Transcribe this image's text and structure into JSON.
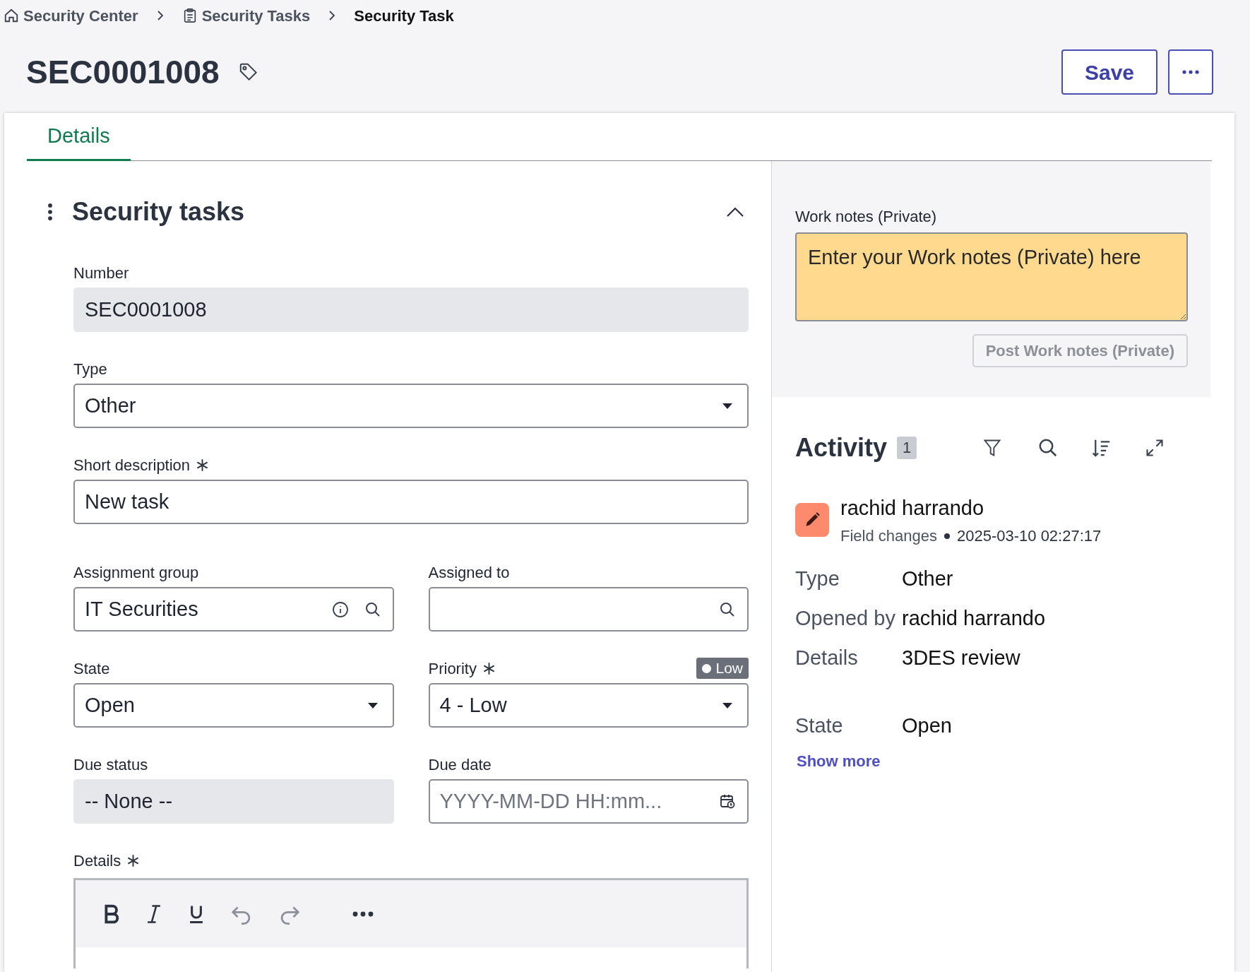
{
  "breadcrumb": [
    {
      "kind": "home",
      "label": "Security Center"
    },
    {
      "kind": "list",
      "label": "Security Tasks"
    },
    {
      "kind": "current",
      "label": "Security Task"
    }
  ],
  "header": {
    "title": "SEC0001008",
    "save": "Save"
  },
  "tabs": [
    {
      "label": "Details",
      "selected": true
    }
  ],
  "section": {
    "title": "Security tasks",
    "expanded": true
  },
  "rows": [
    [
      {
        "kind": "readonly",
        "label": "Number",
        "value": "SEC0001008"
      }
    ],
    [
      {
        "kind": "select",
        "label": "Type",
        "value": "Other"
      }
    ],
    [
      {
        "kind": "text",
        "label": "Short description",
        "required": true,
        "value": "New task"
      }
    ],
    [
      {
        "kind": "reference",
        "label": "Assignment group",
        "value": "IT Securities",
        "info": true
      },
      {
        "kind": "reference",
        "label": "Assigned to"
      }
    ],
    [
      {
        "kind": "select",
        "label": "State",
        "value": "Open"
      },
      {
        "kind": "select",
        "label": "Priority",
        "required": true,
        "value": "4 - Low",
        "badge": "Low"
      }
    ],
    [
      {
        "kind": "readonly",
        "label": "Due status",
        "value": "-- None --"
      },
      {
        "kind": "date",
        "label": "Due date",
        "placeholder": "YYYY-MM-DD HH:mm..."
      }
    ]
  ],
  "editor": {
    "label": "Details",
    "required": true
  },
  "work_notes": {
    "label": "Work notes (Private)",
    "placeholder": "Enter your Work notes (Private) here",
    "button": "Post Work notes (Private)",
    "disabled": true
  },
  "activity": {
    "title": "Activity",
    "count": "1",
    "entries": [
      {
        "author": "rachid harrando",
        "type": "Field changes",
        "timestamp": "2025-03-10 02:27:17",
        "changes": [
          {
            "label": "Type",
            "value": "Other"
          },
          {
            "label": "Opened by",
            "value": "rachid harrando"
          },
          {
            "label": "Details",
            "value": "3DES review"
          },
          {
            "label": "State",
            "value": "Open"
          }
        ]
      }
    ],
    "show_more": "Show more"
  }
}
